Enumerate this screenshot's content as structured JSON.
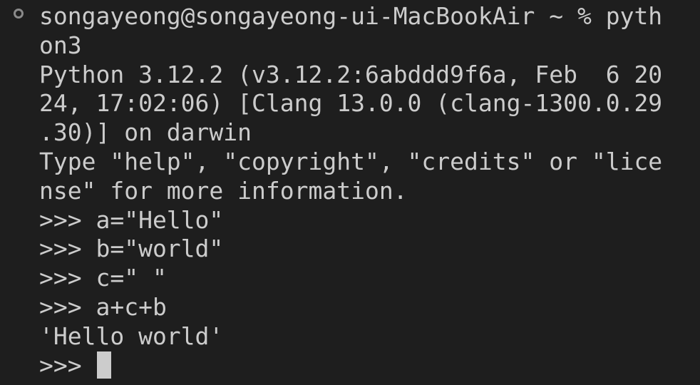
{
  "terminal": {
    "status_indicator": "circle-outline-icon",
    "prompt_text": "songayeong@songayeong-ui-MacBookAir ~ % pyth",
    "lines": [
      "songayeong@songayeong-ui-MacBookAir ~ % pyth",
      "on3",
      "Python 3.12.2 (v3.12.2:6abddd9f6a, Feb  6 20",
      "24, 17:02:06) [Clang 13.0.0 (clang-1300.0.29",
      ".30)] on darwin",
      "Type \"help\", \"copyright\", \"credits\" or \"lice",
      "nse\" for more information.",
      ">>> a=\"Hello\"",
      ">>> b=\"world\"",
      ">>> c=\" \"",
      ">>> a+c+b",
      "'Hello world'"
    ],
    "current_prompt": ">>> ",
    "colors": {
      "background": "#1e1e1e",
      "foreground": "#cccccc",
      "indicator": "#8a8a8a"
    }
  }
}
